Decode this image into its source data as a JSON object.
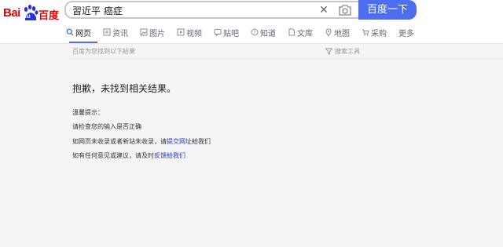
{
  "logo": {
    "text_bai": "Bai",
    "text_du": "du",
    "text_cn": "百度"
  },
  "search": {
    "query": "習近平 癌症",
    "submit_label": "百度一下"
  },
  "tabs": [
    {
      "label": "网页",
      "icon": "search-icon"
    },
    {
      "label": "资讯",
      "icon": "news-icon"
    },
    {
      "label": "图片",
      "icon": "image-icon"
    },
    {
      "label": "视频",
      "icon": "video-icon"
    },
    {
      "label": "贴吧",
      "icon": "tieba-icon"
    },
    {
      "label": "知道",
      "icon": "question-icon"
    },
    {
      "label": "文库",
      "icon": "document-icon"
    },
    {
      "label": "地图",
      "icon": "map-pin-icon"
    },
    {
      "label": "采购",
      "icon": "cart-icon"
    },
    {
      "label": "更多",
      "icon": ""
    }
  ],
  "results": {
    "found_text": "百度为您找到以下結果",
    "tools_label": "搜索工具",
    "no_result": "抱歉，未找到相关结果。",
    "tips_title": "溫馨提示：",
    "tip1": "请检查您的输入是否正确",
    "tip2_prefix": "如网页未收录或者新站未收录，请",
    "tip2_link": "提交网址",
    "tip2_suffix": "給我们",
    "tip3_prefix": "如有任何意见或建议，请及时",
    "tip3_link": "反馈給我们"
  },
  "colors": {
    "brand_red": "#e10601",
    "brand_blue": "#4e6ef2",
    "paw_blue": "#2932e1",
    "link": "#2440b3"
  }
}
